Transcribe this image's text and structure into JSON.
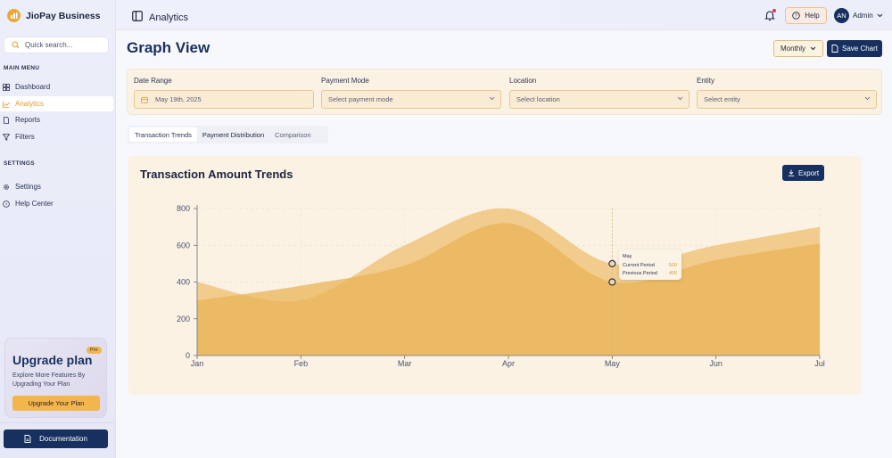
{
  "brand": {
    "name": "JioPay Business"
  },
  "header": {
    "section": "Analytics",
    "help_label": "Help",
    "avatar_initials": "AN",
    "user_name": "Admin"
  },
  "sidebar": {
    "search_placeholder": "Quick search...",
    "main_menu_label": "MAIN MENU",
    "main_items": [
      {
        "label": "Dashboard",
        "icon": "grid-icon"
      },
      {
        "label": "Analytics",
        "icon": "line-chart-icon",
        "active": true
      },
      {
        "label": "Reports",
        "icon": "document-icon"
      },
      {
        "label": "Filters",
        "icon": "filter-icon"
      }
    ],
    "settings_label": "SETTINGS",
    "settings_items": [
      {
        "label": "Settings",
        "icon": "gear-icon"
      },
      {
        "label": "Help Center",
        "icon": "help-circle-icon"
      }
    ],
    "upgrade": {
      "badge": "Pro",
      "title": "Upgrade plan",
      "text": "Explore More Features By Upgrading Your Plan",
      "button": "Upgrade Your Plan"
    },
    "documentation_label": "Documentation"
  },
  "main": {
    "title": "Graph View",
    "period_select": "Monthly",
    "save_chart_label": "Save Chart",
    "filters": {
      "date_range": {
        "label": "Date Range",
        "value": "May 19th, 2025"
      },
      "payment_mode": {
        "label": "Payment Mode",
        "placeholder": "Select payment mode"
      },
      "location": {
        "label": "Location",
        "placeholder": "Select location"
      },
      "entity": {
        "label": "Entity",
        "placeholder": "Select entity"
      }
    },
    "tabs": [
      {
        "label": "Transaction Trends",
        "active": true
      },
      {
        "label": "Payment Distribution"
      },
      {
        "label": "Comparison"
      }
    ],
    "chart_title": "Transaction Amount Trends",
    "export_label": "Export",
    "tooltip": {
      "month": "May",
      "current_label": "Current Period",
      "current_value": "500",
      "previous_label": "Previous Period",
      "previous_value": "400"
    }
  },
  "colors": {
    "navy": "#17305f",
    "accent": "#f3b64c",
    "area_current": "#f0c67e",
    "area_previous": "#eab357"
  },
  "chart_data": {
    "type": "area",
    "x": [
      "Jan",
      "Feb",
      "Mar",
      "Apr",
      "May",
      "Jun",
      "Jul"
    ],
    "series": [
      {
        "name": "Current Period",
        "values": [
          400,
          300,
          600,
          800,
          500,
          600,
          700
        ]
      },
      {
        "name": "Previous Period",
        "values": [
          300,
          380,
          490,
          720,
          400,
          520,
          610
        ]
      }
    ],
    "yticks": [
      0,
      200,
      400,
      600,
      800
    ],
    "ylim": [
      0,
      800
    ],
    "grid": true,
    "highlight": "May"
  }
}
